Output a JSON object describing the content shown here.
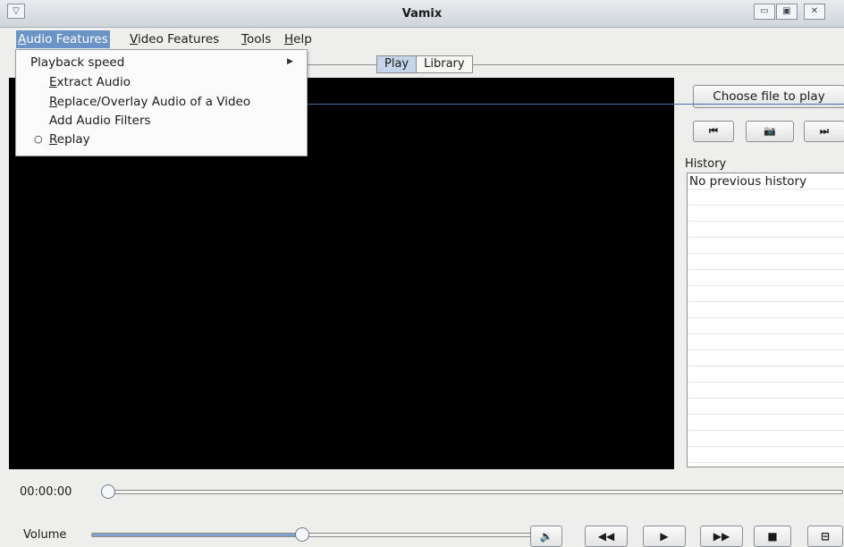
{
  "window": {
    "title": "Vamix",
    "sysmenu_glyph": "▽",
    "minimize": "▭",
    "maximize": "▣",
    "close": "✕"
  },
  "menubar": {
    "items": [
      {
        "label": "Audio Features",
        "underline": "A",
        "rest": "udio Features"
      },
      {
        "label": "Video Features",
        "underline": "V",
        "rest": "ideo Features"
      },
      {
        "label": "Tools",
        "underline": "T",
        "rest": "ools"
      },
      {
        "label": "Help",
        "underline": "H",
        "rest": "elp"
      }
    ]
  },
  "dropdown": {
    "items": [
      {
        "label": "Playback speed",
        "submenu_arrow": "▶"
      },
      {
        "underline": "E",
        "rest": "xtract Audio"
      },
      {
        "underline": "R",
        "rest": "eplace/Overlay Audio of a Video"
      },
      {
        "label": "Add Audio Filters"
      },
      {
        "radio": "○",
        "underline": "R",
        "rest": "eplay"
      }
    ]
  },
  "tabs": {
    "play": "Play",
    "library": "Library"
  },
  "player": {
    "choose_file": "Choose file to play",
    "prev_icon": "⏮",
    "snapshot_icon": "📷",
    "next_icon": "⏭",
    "history_label": "History",
    "history_items": [
      "No previous history"
    ]
  },
  "seek": {
    "time": "00:00:00",
    "position": 0
  },
  "volume": {
    "label": "Volume",
    "level": 0.48,
    "controls": {
      "mute": "🔉",
      "rewind": "◀◀",
      "play": "▶",
      "forward": "▶▶",
      "stop": "■",
      "fullscreen": "⊟"
    }
  },
  "colors": {
    "menu_highlight": "#6a93c6",
    "video_bg": "#000000",
    "tab_selected": "#c5d6ea"
  }
}
